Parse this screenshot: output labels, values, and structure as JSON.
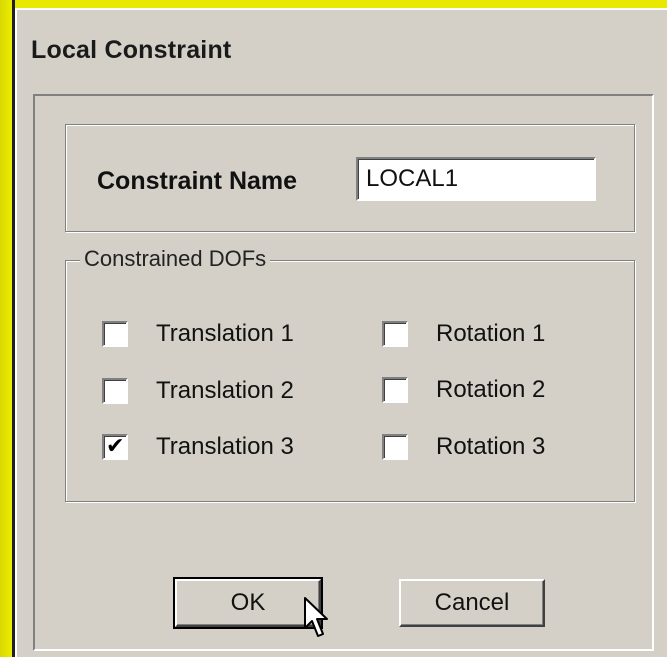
{
  "window": {
    "title": "Local Constraint"
  },
  "name_panel": {
    "label": "Constraint Name",
    "value": "LOCAL1"
  },
  "dof_group": {
    "legend": "Constrained DOFs",
    "checkboxes": [
      {
        "label": "Translation 1",
        "checked": false
      },
      {
        "label": "Translation 2",
        "checked": false
      },
      {
        "label": "Translation 3",
        "checked": true
      },
      {
        "label": "Rotation 1",
        "checked": false
      },
      {
        "label": "Rotation 2",
        "checked": false
      },
      {
        "label": "Rotation 3",
        "checked": false
      }
    ],
    "check_glyph": "✔"
  },
  "buttons": {
    "ok_label": "OK",
    "cancel_label": "Cancel"
  },
  "colors": {
    "desktop": "#e8e800",
    "dialog": "#d4d0c8"
  }
}
